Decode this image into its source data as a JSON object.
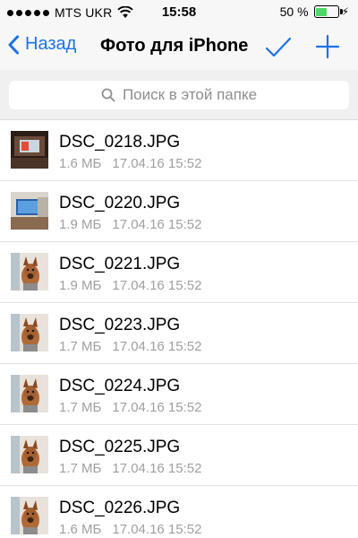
{
  "status_bar": {
    "carrier": "MTS UKR",
    "time": "15:58",
    "battery": "50 %",
    "battery_level": 0.5,
    "battery_color": "#4cd964"
  },
  "nav": {
    "back_label": "Назад",
    "title": "Фото для iPhone",
    "accent_color": "#1a73e8",
    "icons": [
      "chevron-left-icon",
      "checkmark-icon",
      "plus-icon"
    ]
  },
  "search": {
    "placeholder": "Поиск в этой папке",
    "icon": "search-icon"
  },
  "files": [
    {
      "name": "DSC_0218.JPG",
      "size": "1.6 МБ",
      "date": "17.04.16 15:52",
      "thumb": "desk-photo"
    },
    {
      "name": "DSC_0220.JPG",
      "size": "1.9 МБ",
      "date": "17.04.16 15:52",
      "thumb": "room-photo"
    },
    {
      "name": "DSC_0221.JPG",
      "size": "1.9 МБ",
      "date": "17.04.16 15:52",
      "thumb": "dog-photo"
    },
    {
      "name": "DSC_0223.JPG",
      "size": "1.7 МБ",
      "date": "17.04.16 15:52",
      "thumb": "dog-photo"
    },
    {
      "name": "DSC_0224.JPG",
      "size": "1.7 МБ",
      "date": "17.04.16 15:52",
      "thumb": "dog-photo"
    },
    {
      "name": "DSC_0225.JPG",
      "size": "1.7 МБ",
      "date": "17.04.16 15:52",
      "thumb": "dog-photo"
    },
    {
      "name": "DSC_0226.JPG",
      "size": "1.6 МБ",
      "date": "17.04.16 15:52",
      "thumb": "dog-photo"
    }
  ]
}
